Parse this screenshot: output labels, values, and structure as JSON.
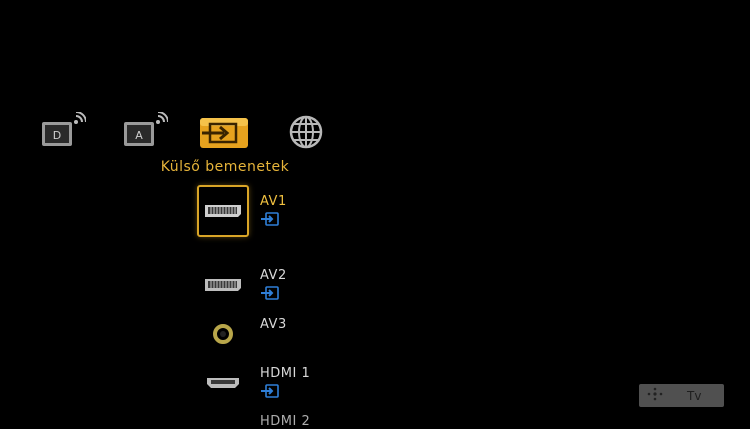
{
  "categories": [
    {
      "name": "digital-broadcast",
      "badge": "D"
    },
    {
      "name": "analog-broadcast",
      "badge": "A"
    },
    {
      "name": "external-inputs",
      "selected": true
    },
    {
      "name": "internet"
    }
  ],
  "selected_category_label": "Külső bemenetek",
  "inputs": [
    {
      "label": "AV1",
      "icon": "scart-icon",
      "selected": true,
      "has_input_badge": true
    },
    {
      "label": "AV2",
      "icon": "scart-icon",
      "has_input_badge": true
    },
    {
      "label": "AV3",
      "icon": "composite-jack-icon"
    },
    {
      "label": "HDMI 1",
      "icon": "hdmi-icon",
      "has_input_badge": true
    },
    {
      "label": "HDMI 2",
      "icon": "hdmi-icon"
    }
  ],
  "footer": {
    "tv_button_label": "Tv"
  },
  "colors": {
    "accent": "#e6b43a",
    "badge_blue": "#2f7fd8",
    "background": "#000000"
  }
}
